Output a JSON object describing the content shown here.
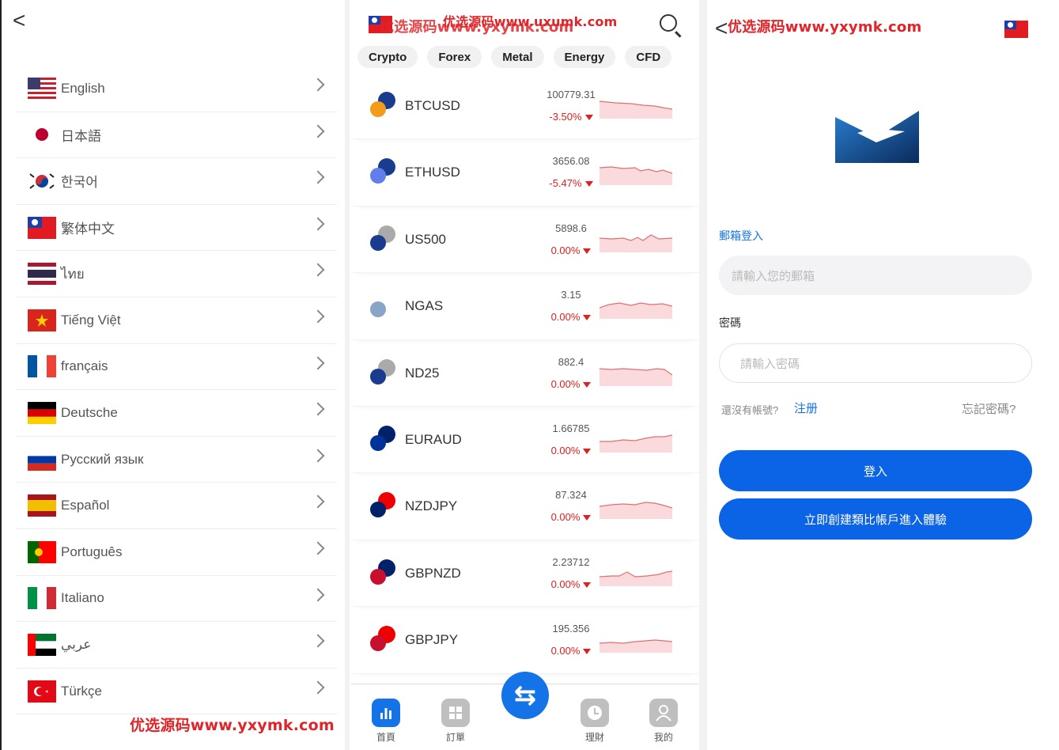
{
  "language_panel": {
    "languages": [
      {
        "label": "English",
        "flag": "us-flag-icon"
      },
      {
        "label": "日本語",
        "flag": "japan-flag-icon"
      },
      {
        "label": "한국어",
        "flag": "korea-flag-icon"
      },
      {
        "label": "繁体中文",
        "flag": "taiwan-flag-icon"
      },
      {
        "label": "ไทย",
        "flag": "thailand-flag-icon"
      },
      {
        "label": "Tiếng Việt",
        "flag": "vietnam-flag-icon"
      },
      {
        "label": "français",
        "flag": "france-flag-icon"
      },
      {
        "label": "Deutsche",
        "flag": "germany-flag-icon"
      },
      {
        "label": "Русский язык",
        "flag": "russia-flag-icon"
      },
      {
        "label": "Español",
        "flag": "spain-flag-icon"
      },
      {
        "label": "Português",
        "flag": "portugal-flag-icon"
      },
      {
        "label": "Italiano",
        "flag": "italy-flag-icon"
      },
      {
        "label": "عربي",
        "flag": "uae-flag-icon"
      },
      {
        "label": "Türkçe",
        "flag": "turkey-flag-icon"
      }
    ],
    "watermark": "优选源码www.yxymk.com"
  },
  "market_panel": {
    "watermark_a": "优选源码www.yxymk.com",
    "watermark_b": "优选源码www.uxumk.com",
    "tabs": [
      "Crypto",
      "Forex",
      "Metal",
      "Energy",
      "CFD"
    ],
    "markets": [
      {
        "symbol": "BTCUSD",
        "price": "100779.31",
        "change": "-3.50%"
      },
      {
        "symbol": "ETHUSD",
        "price": "3656.08",
        "change": "-5.47%"
      },
      {
        "symbol": "US500",
        "price": "5898.6",
        "change": "0.00%"
      },
      {
        "symbol": "NGAS",
        "price": "3.15",
        "change": "0.00%"
      },
      {
        "symbol": "ND25",
        "price": "882.4",
        "change": "0.00%"
      },
      {
        "symbol": "EURAUD",
        "price": "1.66785",
        "change": "0.00%"
      },
      {
        "symbol": "NZDJPY",
        "price": "87.324",
        "change": "0.00%"
      },
      {
        "symbol": "GBPNZD",
        "price": "2.23712",
        "change": "0.00%"
      },
      {
        "symbol": "GBPJPY",
        "price": "195.356",
        "change": "0.00%"
      }
    ],
    "nav": [
      {
        "label": "首頁",
        "icon": "chart-icon"
      },
      {
        "label": "訂單",
        "icon": "grid-icon"
      },
      {
        "label": "理財",
        "icon": "clock-icon"
      },
      {
        "label": "我的",
        "icon": "user-icon"
      }
    ],
    "accent_color": "#1473e6",
    "down_color": "#e02020"
  },
  "login_panel": {
    "watermark": "优选源码www.yxymk.com",
    "email_label": "郵箱登入",
    "email_placeholder": "請輸入您的郵箱",
    "password_label": "密碼",
    "password_placeholder": "請輸入密碼",
    "no_account": "還沒有帳號?",
    "register": "注册",
    "forgot": "忘記密碼?",
    "login_button": "登入",
    "demo_button": "立即創建類比帳戶進入體驗"
  }
}
